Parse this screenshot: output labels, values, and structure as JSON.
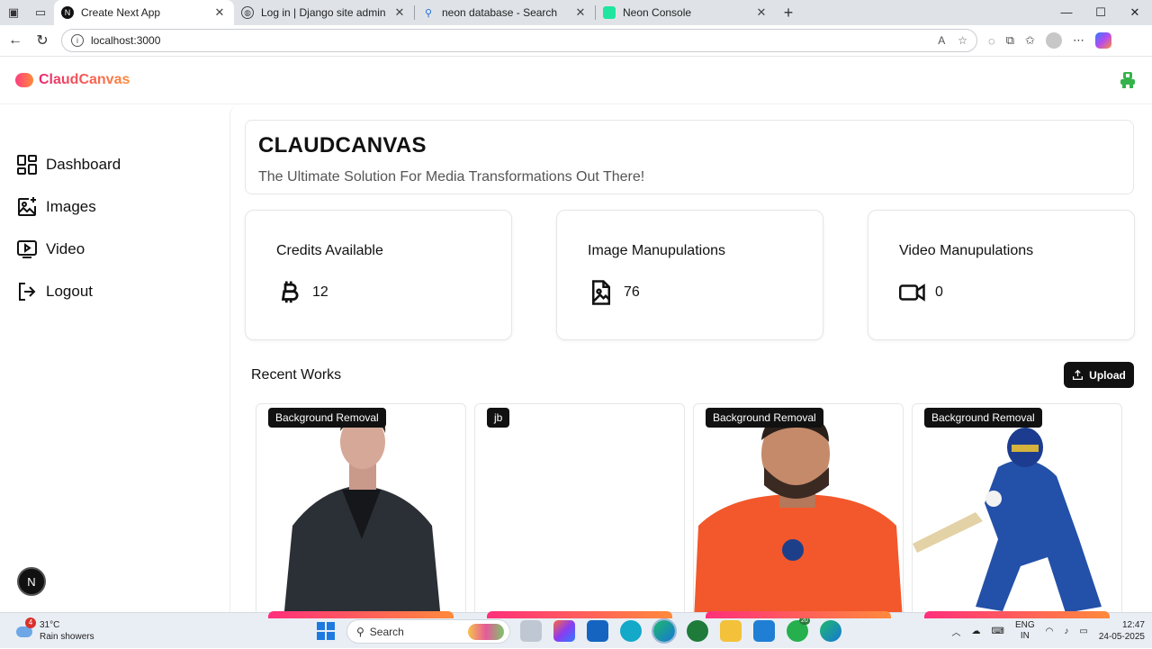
{
  "browser": {
    "tabs": [
      {
        "title": "Create Next App",
        "active": true
      },
      {
        "title": "Log in | Django site admin",
        "active": false
      },
      {
        "title": "neon database - Search",
        "active": false
      },
      {
        "title": "Neon Console",
        "active": false
      }
    ],
    "url": "localhost:3000"
  },
  "app": {
    "brand": "ClaudCanvas",
    "sidebar": {
      "items": [
        {
          "label": "Dashboard",
          "icon": "dashboard-icon"
        },
        {
          "label": "Images",
          "icon": "image-add-icon"
        },
        {
          "label": "Video",
          "icon": "video-icon"
        },
        {
          "label": "Logout",
          "icon": "logout-icon"
        }
      ],
      "dev_badge": "N"
    },
    "hero": {
      "title": "CLAUDCANVAS",
      "subtitle": "The Ultimate Solution For Media Transformations Out There!"
    },
    "stats": [
      {
        "label": "Credits Available",
        "value": "12",
        "icon": "bitcoin-icon"
      },
      {
        "label": "Image Manupulations",
        "value": "76",
        "icon": "image-file-icon"
      },
      {
        "label": "Video Manupulations",
        "value": "0",
        "icon": "video-camera-icon"
      }
    ],
    "recent": {
      "title": "Recent Works",
      "upload_label": "Upload",
      "cards": [
        {
          "tag": "Background Removal"
        },
        {
          "tag": "jb"
        },
        {
          "tag": "Background Removal"
        },
        {
          "tag": "Background Removal"
        }
      ]
    }
  },
  "taskbar": {
    "weather_temp": "31°C",
    "weather_desc": "Rain showers",
    "weather_badge": "4",
    "search_label": "Search",
    "lang_1": "ENG",
    "lang_2": "IN",
    "time": "12:47",
    "date": "24-05-2025"
  }
}
